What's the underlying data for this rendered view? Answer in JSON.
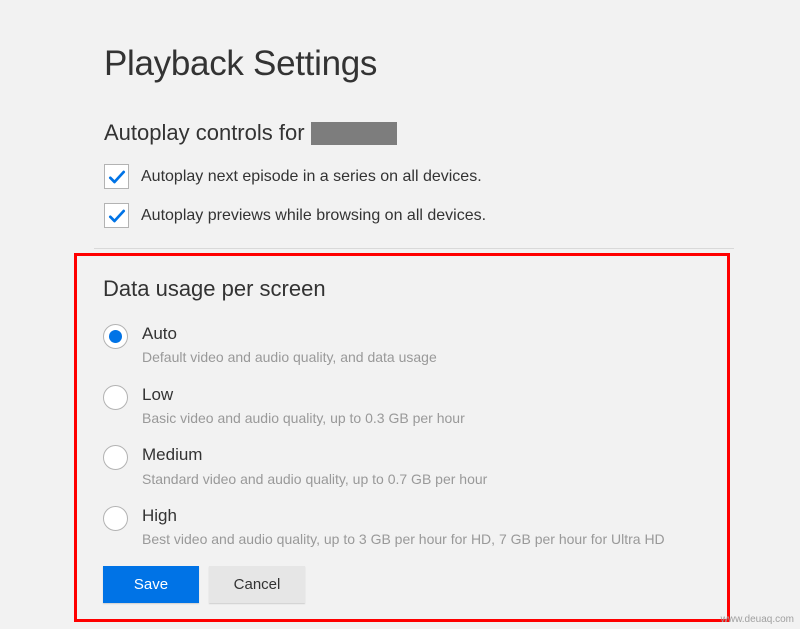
{
  "page_title": "Playback Settings",
  "autoplay": {
    "title_prefix": "Autoplay controls for",
    "checkboxes": [
      {
        "checked": true,
        "label": "Autoplay next episode in a series on all devices."
      },
      {
        "checked": true,
        "label": "Autoplay previews while browsing on all devices."
      }
    ]
  },
  "data_usage": {
    "title": "Data usage per screen",
    "options": [
      {
        "selected": true,
        "label": "Auto",
        "desc": "Default video and audio quality, and data usage"
      },
      {
        "selected": false,
        "label": "Low",
        "desc": "Basic video and audio quality, up to 0.3 GB per hour"
      },
      {
        "selected": false,
        "label": "Medium",
        "desc": "Standard video and audio quality, up to 0.7 GB per hour"
      },
      {
        "selected": false,
        "label": "High",
        "desc": "Best video and audio quality, up to 3 GB per hour for HD, 7 GB per hour for Ultra HD"
      }
    ]
  },
  "buttons": {
    "save": "Save",
    "cancel": "Cancel"
  },
  "watermark": "www.deuaq.com"
}
